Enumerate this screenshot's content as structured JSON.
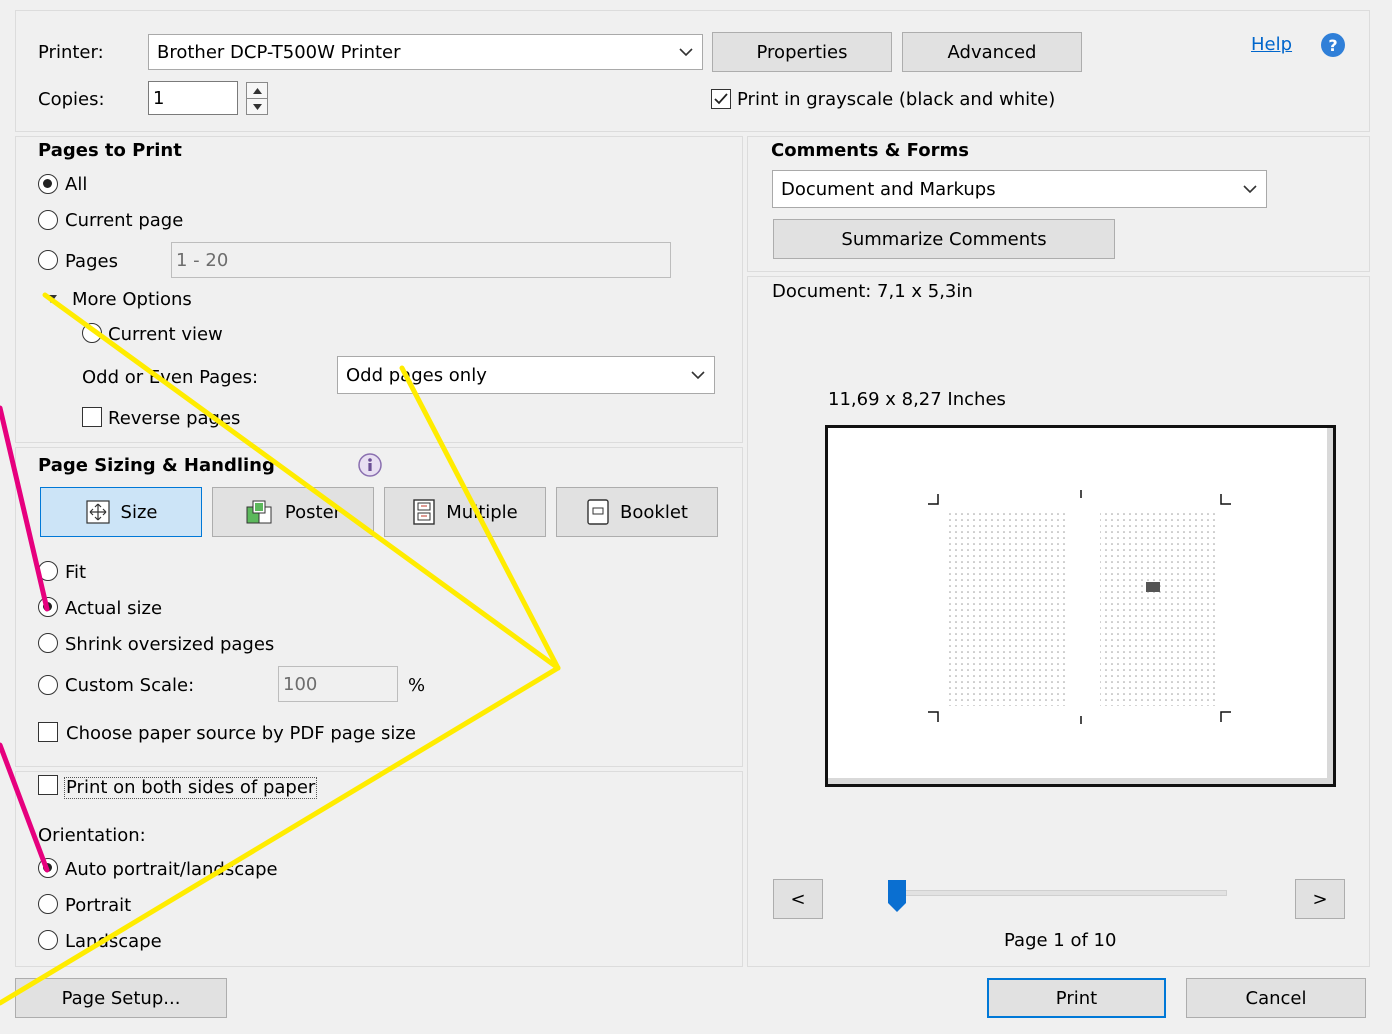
{
  "header": {
    "printer_label": "Printer:",
    "printer_value": "Brother DCP-T500W Printer",
    "properties_label": "Properties",
    "advanced_label": "Advanced",
    "help_label": "Help",
    "copies_label": "Copies:",
    "copies_value": "1",
    "grayscale_label": "Print in grayscale (black and white)",
    "grayscale_checked": true
  },
  "pages_to_print": {
    "title": "Pages to Print",
    "all_label": "All",
    "current_page_label": "Current page",
    "pages_label": "Pages",
    "pages_value": "1 - 20",
    "more_options_label": "More Options",
    "current_view_label": "Current view",
    "odd_even_label": "Odd or Even Pages:",
    "odd_even_value": "Odd pages only",
    "reverse_pages_label": "Reverse pages",
    "selected": "All"
  },
  "page_sizing": {
    "title": "Page Sizing & Handling",
    "tabs": [
      {
        "label": "Size"
      },
      {
        "label": "Poster"
      },
      {
        "label": "Multiple"
      },
      {
        "label": "Booklet"
      }
    ],
    "active_tab": "Size",
    "fit_label": "Fit",
    "actual_size_label": "Actual size",
    "shrink_label": "Shrink oversized pages",
    "custom_scale_label": "Custom Scale:",
    "custom_scale_value": "100",
    "percent_label": "%",
    "paper_source_label": "Choose paper source by PDF page size",
    "selected": "Actual size"
  },
  "duplex": {
    "both_sides_label": "Print on both sides of paper",
    "orientation_label": "Orientation:",
    "auto_label": "Auto portrait/landscape",
    "portrait_label": "Portrait",
    "landscape_label": "Landscape",
    "selected": "Auto portrait/landscape"
  },
  "comments_forms": {
    "title": "Comments & Forms",
    "value": "Document and Markups",
    "summarize_label": "Summarize Comments"
  },
  "preview": {
    "document_label": "Document: 7,1 x 5,3in",
    "paper_label": "11,69 x 8,27 Inches",
    "prev_label": "<",
    "next_label": ">",
    "page_label": "Page 1 of 10",
    "slider_position": 0.0
  },
  "footer": {
    "page_setup_label": "Page Setup...",
    "print_label": "Print",
    "cancel_label": "Cancel"
  },
  "colors": {
    "accent": "#0078d7",
    "help_link": "#0066cc",
    "annotation_yellow": "#ffec00",
    "annotation_pink": "#e6007e"
  }
}
